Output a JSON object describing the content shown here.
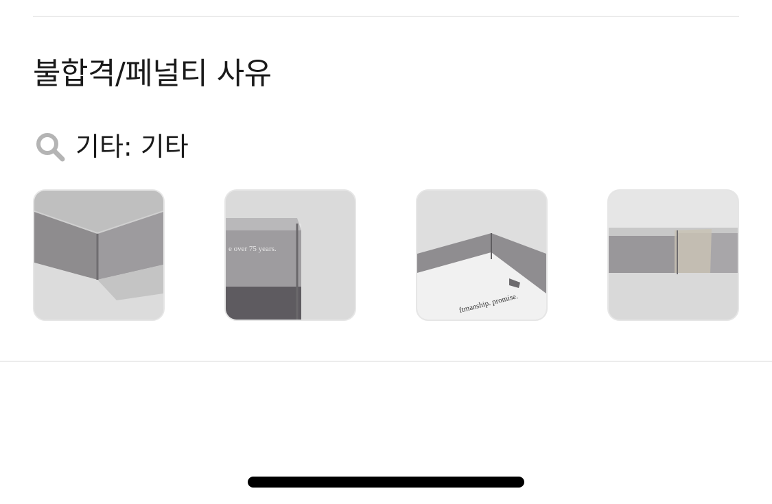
{
  "section": {
    "title": "불합격/페널티 사유"
  },
  "reason": {
    "icon": "search-icon",
    "text": "기타: 기타"
  },
  "photos": [
    {
      "alt": "package-corner-photo-1",
      "overlay_text": ""
    },
    {
      "alt": "package-corner-photo-2",
      "overlay_text": "e over 75 years."
    },
    {
      "alt": "package-corner-photo-3",
      "overlay_text": "ftmanship. promise."
    },
    {
      "alt": "package-edge-photo-4",
      "overlay_text": ""
    }
  ],
  "colors": {
    "divider": "#ebebeb",
    "icon": "#b4b4b4",
    "text": "#1a1a1a",
    "home_indicator": "#000000"
  }
}
